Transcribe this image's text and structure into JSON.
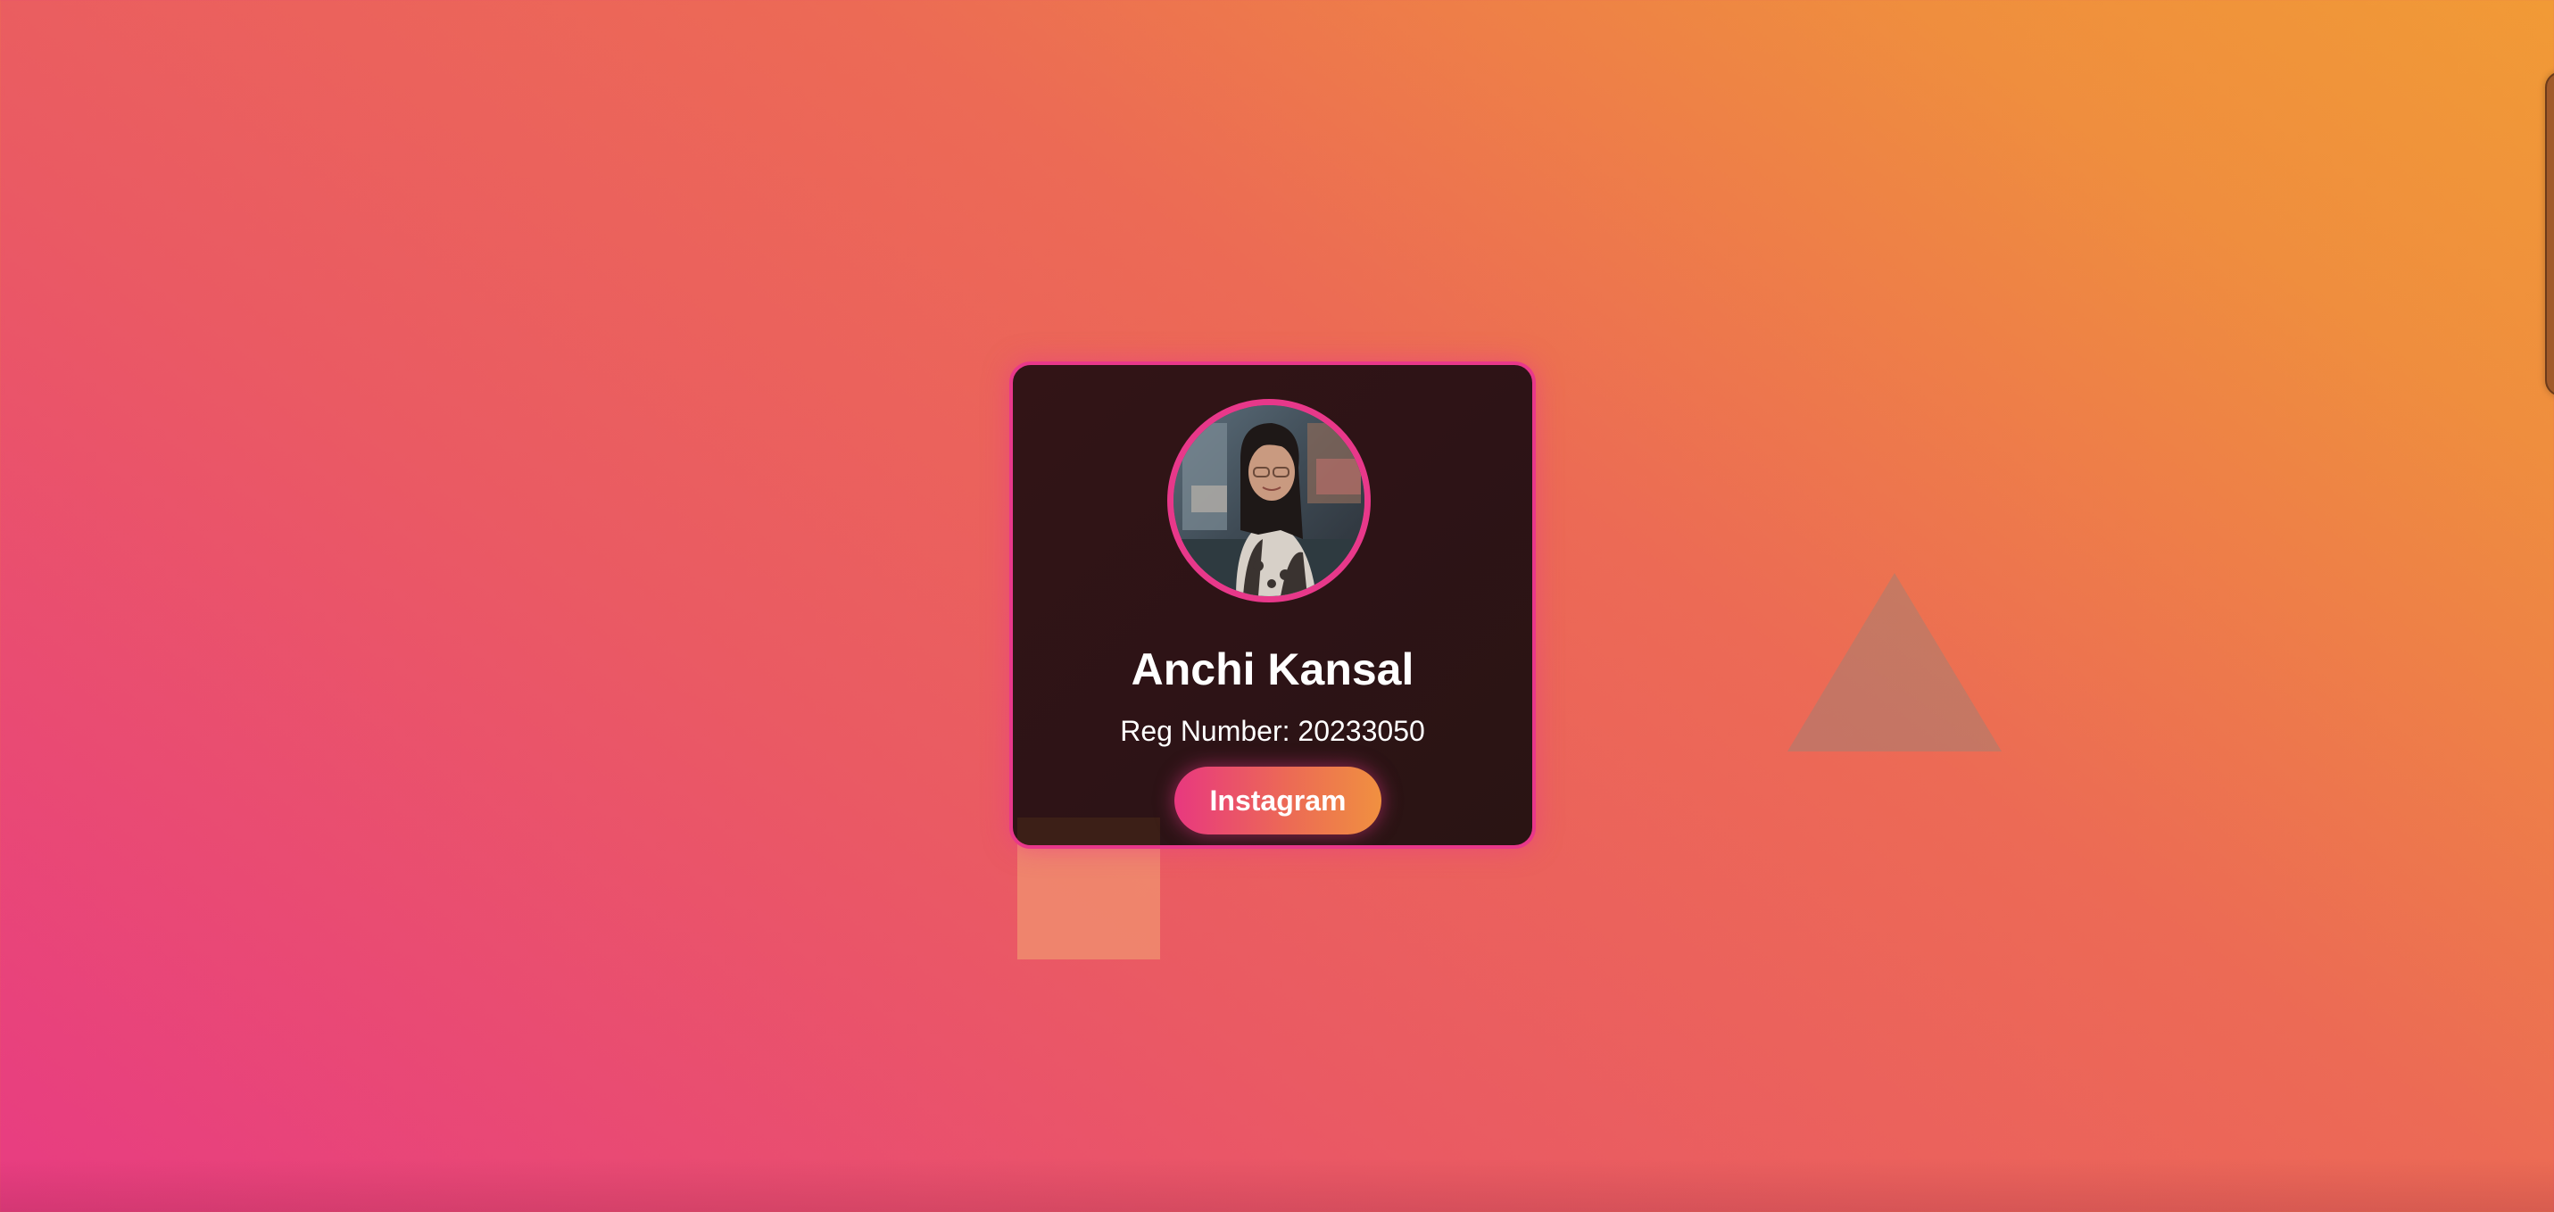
{
  "profile": {
    "name": "Anchi Kansal",
    "reg_label": "Reg Number:",
    "reg_number": "20233050",
    "instagram_label": "Instagram"
  },
  "colors": {
    "accent": "#e8388a",
    "card_bg": "#2d1316",
    "background_start": "#e83c82",
    "background_end": "#f19a36"
  }
}
